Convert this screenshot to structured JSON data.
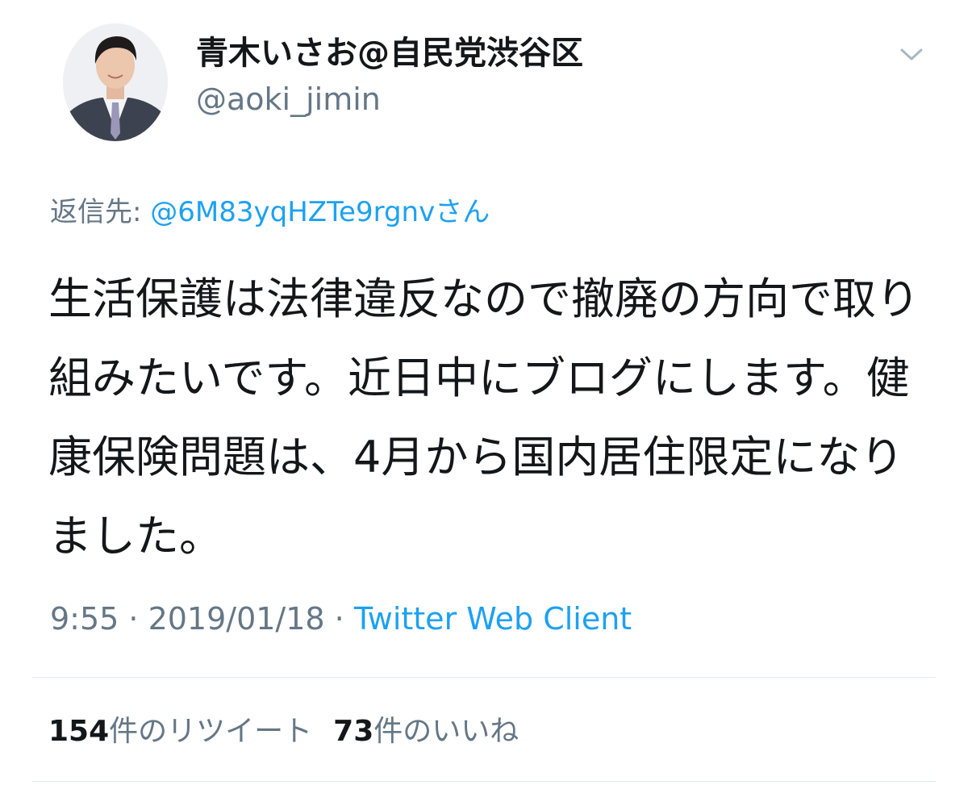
{
  "author": {
    "display_name": "青木いさお@自民党渋谷区",
    "screen_name": "@aoki_jimin",
    "avatar_icon": "person-avatar-icon"
  },
  "more_icon": "chevron-down-icon",
  "reply_to": {
    "prefix": "返信先: ",
    "handle": "@6M83yqHZTe9rgnvさん"
  },
  "tweet_text": "生活保護は法律違反なので撤廃の方向で取り組みたいです。近日中にブログにします。健康保険問題は、4月から国内居住限定になりました。",
  "meta": {
    "time_date": "9:55 · 2019/01/18 · ",
    "source": "Twitter Web Client"
  },
  "stats": {
    "retweets_count": "154",
    "retweets_label": "件のリツイート",
    "likes_count": "73",
    "likes_label": "件のいいね"
  },
  "colors": {
    "link": "#1da1f2",
    "secondary_text": "#657786",
    "primary_text": "#14171a",
    "divider": "#e1e8ed"
  }
}
